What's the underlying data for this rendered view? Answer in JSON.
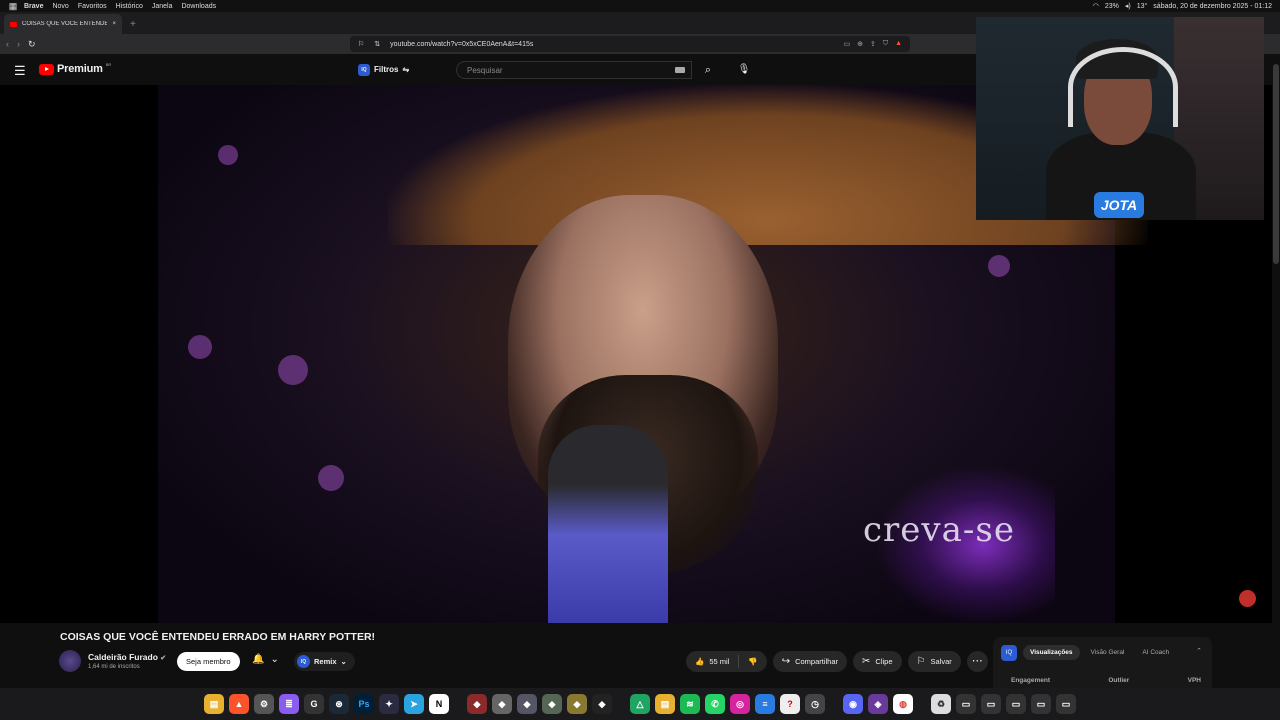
{
  "menubar": {
    "items": [
      "Brave",
      "Novo",
      "Favoritos",
      "Histórico",
      "Janela",
      "Downloads"
    ],
    "battery": "23%",
    "temperature": "13°",
    "datetime": "sábado, 20 de dezembro 2025 - 01:12"
  },
  "tab": {
    "title": "COISAS QUE VOCÊ ENTENDEU E",
    "close": "×",
    "new_tab": "+"
  },
  "address": {
    "url": "youtube.com/watch?v=0x5xCE0AenA&t=415s"
  },
  "youtube": {
    "brand": "Premium",
    "country": "BR",
    "filters_label": "Filtros",
    "search_placeholder": "Pesquisar"
  },
  "video": {
    "overlay_text": "creva-se",
    "webcam_badge": "JOTA"
  },
  "details": {
    "title": "COISAS QUE VOCÊ ENTENDEU ERRADO EM HARRY POTTER!",
    "channel_name": "Caldeirão Furado",
    "subscribers": "1,64 mi de inscritos",
    "member_button": "Seja membro",
    "remix_label": "Remix",
    "likes": "55 mil",
    "share": "Compartilhar",
    "clip": "Clipe",
    "save": "Salvar"
  },
  "analytics": {
    "tabs": [
      "Visualizações",
      "Visão Geral",
      "AI Coach"
    ],
    "columns": [
      "Engagement",
      "Outlier",
      "VPH"
    ]
  },
  "dock": {
    "apps": [
      "folder-icon",
      "brave-icon",
      "settings-icon",
      "notes-icon",
      "steam-icon",
      "photoshop-icon",
      "davinci-icon",
      "telegram-icon",
      "notion-icon",
      "game-icon",
      "drive-icon",
      "spotify-icon",
      "whatsapp-icon",
      "instagram-icon",
      "discord-icon",
      "chrome-icon",
      "trash-icon"
    ]
  },
  "colors": {
    "youtube_red": "#ff0000",
    "background": "#0f0f0f",
    "accent_blue": "#2d5bd1"
  }
}
